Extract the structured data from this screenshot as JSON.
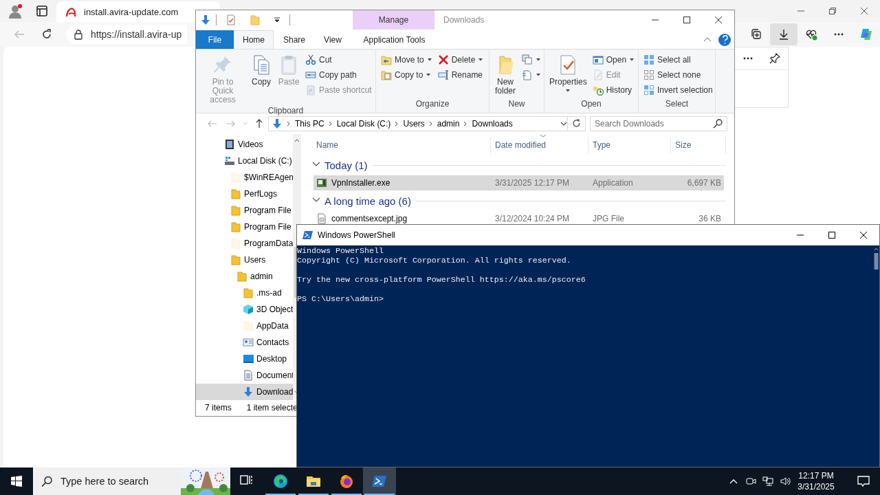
{
  "browser": {
    "tabs": [
      {
        "title": "install.avira-update.com",
        "selected": true
      }
    ],
    "address": "https://install.avira-up",
    "downloads_open": true
  },
  "explorer": {
    "title": "Downloads",
    "context_header": "Manage",
    "ribbon_tabs": [
      {
        "label": "File",
        "kind": "file",
        "selected": false
      },
      {
        "label": "Home",
        "kind": "tab",
        "selected": true
      },
      {
        "label": "Share",
        "kind": "tab",
        "selected": false
      },
      {
        "label": "View",
        "kind": "tab",
        "selected": false
      },
      {
        "label": "Application Tools",
        "kind": "context",
        "selected": false
      }
    ],
    "ribbon_groups": [
      {
        "label": "Clipboard",
        "columns": [
          {
            "kind": "large",
            "items": [
              {
                "label": "Pin to Quick access",
                "kind": "pin",
                "disabled": true,
                "dropdown": false
              }
            ]
          },
          {
            "kind": "large",
            "items": [
              {
                "label": "Copy",
                "kind": "copy",
                "disabled": false,
                "dropdown": false
              }
            ]
          },
          {
            "kind": "large",
            "items": [
              {
                "label": "Paste",
                "kind": "paste",
                "disabled": true,
                "dropdown": false
              }
            ]
          },
          {
            "kind": "small",
            "items": [
              {
                "label": "Cut",
                "kind": "cut",
                "disabled": false,
                "dropdown": false
              },
              {
                "label": "Copy path",
                "kind": "copypath",
                "disabled": false,
                "dropdown": false
              },
              {
                "label": "Paste shortcut",
                "kind": "shortcut",
                "disabled": true,
                "dropdown": false
              }
            ]
          }
        ]
      },
      {
        "label": "Organize",
        "columns": [
          {
            "kind": "small",
            "items": [
              {
                "label": "Move to",
                "kind": "moveto",
                "disabled": false,
                "dropdown": true
              },
              {
                "label": "Copy to",
                "kind": "copyto",
                "disabled": false,
                "dropdown": true
              }
            ]
          },
          {
            "kind": "small",
            "items": [
              {
                "label": "Delete",
                "kind": "delete",
                "disabled": false,
                "dropdown": true
              },
              {
                "label": "Rename",
                "kind": "rename",
                "disabled": false,
                "dropdown": false
              }
            ]
          }
        ]
      },
      {
        "label": "New",
        "columns": [
          {
            "kind": "large",
            "items": [
              {
                "label": "New folder",
                "kind": "newfolder",
                "disabled": false,
                "dropdown": false
              }
            ]
          },
          {
            "kind": "small",
            "items": [
              {
                "kind": "newitem",
                "disabled": false,
                "dropdown": true
              },
              {
                "kind": "easyaccess",
                "disabled": false,
                "dropdown": true
              }
            ]
          }
        ]
      },
      {
        "label": "Open",
        "columns": [
          {
            "kind": "large",
            "items": [
              {
                "label": "Properties",
                "kind": "properties",
                "disabled": false,
                "dropdown": true
              }
            ]
          },
          {
            "kind": "small",
            "items": [
              {
                "label": "Open",
                "kind": "open",
                "disabled": false,
                "dropdown": true
              },
              {
                "label": "Edit",
                "kind": "edit",
                "disabled": true,
                "dropdown": false
              },
              {
                "label": "History",
                "kind": "history",
                "disabled": false,
                "dropdown": false
              }
            ]
          }
        ]
      },
      {
        "label": "Select",
        "columns": [
          {
            "kind": "small",
            "items": [
              {
                "label": "Select all",
                "kind": "selectall",
                "disabled": false,
                "dropdown": false
              },
              {
                "label": "Select none",
                "kind": "selectnone",
                "disabled": false,
                "dropdown": false
              },
              {
                "label": "Invert selection",
                "kind": "invert",
                "disabled": false,
                "dropdown": false
              }
            ]
          }
        ]
      }
    ],
    "breadcrumb": [
      "This PC",
      "Local Disk (C:)",
      "Users",
      "admin",
      "Downloads"
    ],
    "search_placeholder": "Search Downloads",
    "nav": [
      {
        "label": "Videos",
        "kind": "videos",
        "selected": false
      },
      {
        "label": "Local Disk (C:)",
        "kind": "drive",
        "selected": false,
        "children": [
          {
            "label": "$WinREAgen",
            "kind": "folder",
            "selected": false,
            "hidden": true
          },
          {
            "label": "PerfLogs",
            "kind": "folder",
            "selected": false,
            "hidden": false
          },
          {
            "label": "Program File",
            "kind": "folder",
            "selected": false,
            "hidden": false
          },
          {
            "label": "Program File",
            "kind": "folder",
            "selected": false,
            "hidden": false
          },
          {
            "label": "ProgramData",
            "kind": "folder",
            "selected": false,
            "hidden": true
          },
          {
            "label": "Users",
            "kind": "folder",
            "selected": false,
            "hidden": false,
            "children": [
              {
                "label": "admin",
                "kind": "folder",
                "selected": false,
                "hidden": false,
                "children": [
                  {
                    "label": ".ms-ad",
                    "kind": "folder",
                    "selected": false,
                    "hidden": false
                  },
                  {
                    "label": "3D Object",
                    "kind": "objects3d",
                    "selected": false
                  },
                  {
                    "label": "AppData",
                    "kind": "folder",
                    "selected": false,
                    "hidden": true
                  },
                  {
                    "label": "Contacts",
                    "kind": "contacts",
                    "selected": false
                  },
                  {
                    "label": "Desktop",
                    "kind": "desktop",
                    "selected": false
                  },
                  {
                    "label": "Document",
                    "kind": "documents",
                    "selected": false
                  },
                  {
                    "label": "Download",
                    "kind": "downloads",
                    "selected": true
                  }
                ]
              }
            ]
          }
        ]
      }
    ],
    "columns": [
      {
        "label": "Name",
        "sorted": false
      },
      {
        "label": "Date modified",
        "sorted": true
      },
      {
        "label": "Type",
        "sorted": false
      },
      {
        "label": "Size",
        "sorted": false
      }
    ],
    "groups": [
      {
        "label": "Today (1)",
        "expanded": true,
        "rows": [
          {
            "kind": "exe",
            "selected": true,
            "cells": [
              "VpnInstaller.exe",
              "3/31/2025 12:17 PM",
              "Application",
              "6,697 KB"
            ]
          }
        ]
      },
      {
        "label": "A long time ago (6)",
        "expanded": true,
        "rows": [
          {
            "kind": "jpg",
            "selected": false,
            "cells": [
              "commentsexcept.jpg",
              "3/12/2024 10:24 PM",
              "JPG File",
              "36 KB"
            ]
          }
        ]
      }
    ],
    "status": [
      "7 items",
      "1 item selecte"
    ]
  },
  "powershell": {
    "title": "Windows PowerShell",
    "paragraphs": [
      [
        "Windows PowerShell",
        "Copyright (C) Microsoft Corporation. All rights reserved."
      ],
      [
        "Try the new cross-platform PowerShell https://aka.ms/pscore6"
      ],
      [
        "PS C:\\Users\\admin>"
      ]
    ]
  },
  "taskbar": {
    "search_placeholder": "Type here to search",
    "apps": [
      {
        "running": false,
        "selected": false
      },
      {
        "running": true,
        "selected": false
      },
      {
        "running": true,
        "selected": false
      },
      {
        "running": true,
        "selected": false
      },
      {
        "running": true,
        "selected": true
      }
    ],
    "time": "12:17 PM",
    "date": "3/31/2025"
  }
}
